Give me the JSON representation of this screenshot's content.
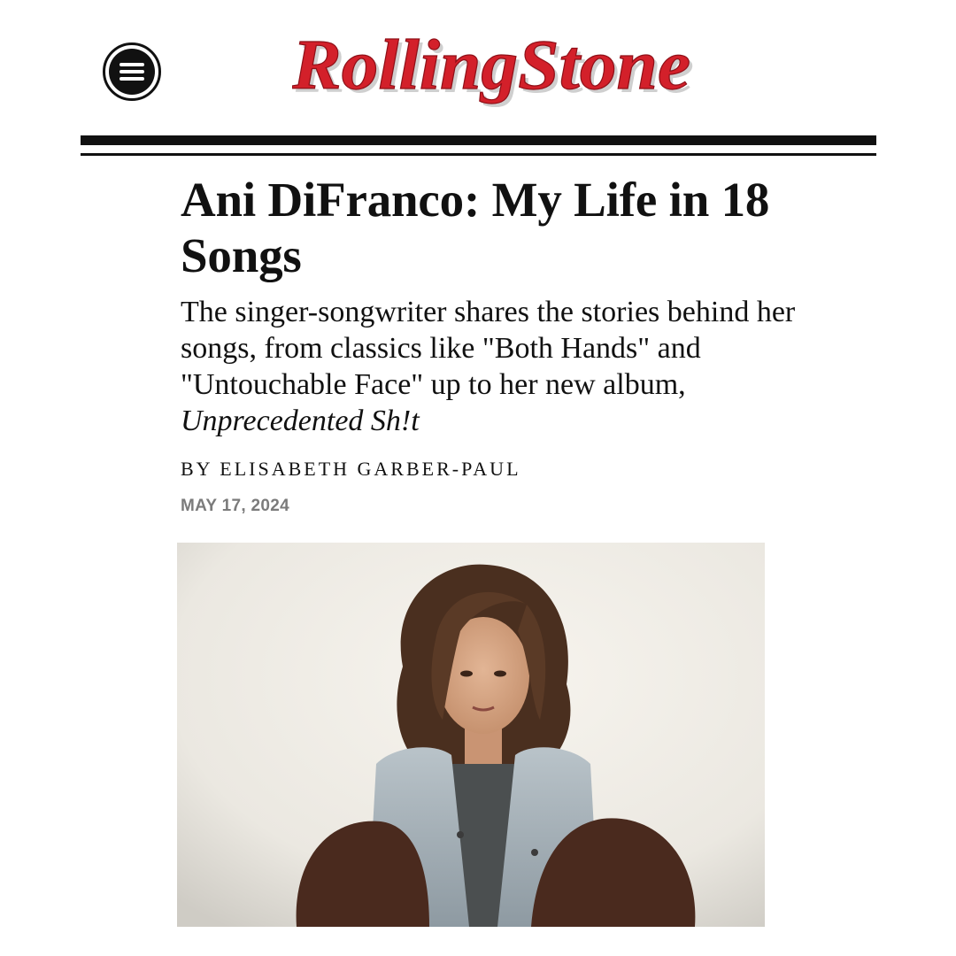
{
  "header": {
    "menu_icon": "hamburger-menu-icon",
    "logo_text": "RollingStone",
    "logo_color": "#d3202a"
  },
  "article": {
    "title": "Ani DiFranco: My Life in 18 Songs",
    "dek_text": "The singer-songwriter shares the stories behind her songs, from classics like \"Both Hands\" and \"Untouchable Face\" up to her new album, ",
    "dek_album": "Unprecedented Sh!t",
    "byline_prefix": "BY",
    "author": "ELISABETH GARBER-PAUL",
    "date": "MAY 17, 2024"
  },
  "hero": {
    "description_icon": "portrait-photo"
  }
}
